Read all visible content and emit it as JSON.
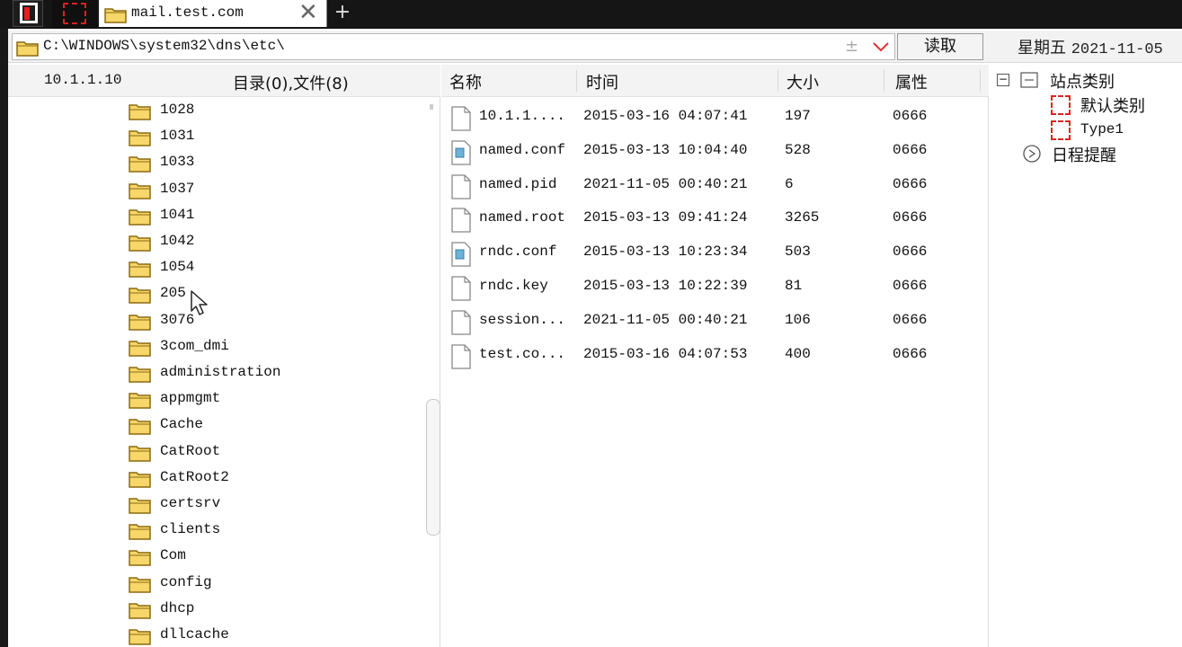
{
  "tab": {
    "title": "mail.test.com",
    "close": "✕",
    "new_tab": "+"
  },
  "address": {
    "path": "C:\\WINDOWS\\system32\\dns\\etc\\",
    "plusminus": "±",
    "read_button": "读取",
    "weekday": "星期五",
    "date": "2021-11-05"
  },
  "left_pane": {
    "host": "10.1.1.10",
    "summary": "目录(0),文件(8)",
    "folders": [
      "1028",
      "1031",
      "1033",
      "1037",
      "1041",
      "1042",
      "1054",
      "205",
      "3076",
      "3com_dmi",
      "administration",
      "appmgmt",
      "Cache",
      "CatRoot",
      "CatRoot2",
      "certsrv",
      "clients",
      "Com",
      "config",
      "dhcp",
      "dllcache"
    ]
  },
  "file_list": {
    "headers": {
      "name": "名称",
      "time": "时间",
      "size": "大小",
      "attr": "属性"
    },
    "rows": [
      {
        "name": "10.1.1....",
        "time": "2015-03-16 04:07:41",
        "size": "197",
        "attr": "0666",
        "icon": "blank-file-icon"
      },
      {
        "name": "named.conf",
        "time": "2015-03-13 10:04:40",
        "size": "528",
        "attr": "0666",
        "icon": "config-file-icon"
      },
      {
        "name": "named.pid",
        "time": "2021-11-05 00:40:21",
        "size": "6",
        "attr": "0666",
        "icon": "blank-file-icon"
      },
      {
        "name": "named.root",
        "time": "2015-03-13 09:41:24",
        "size": "3265",
        "attr": "0666",
        "icon": "blank-file-icon"
      },
      {
        "name": "rndc.conf",
        "time": "2015-03-13 10:23:34",
        "size": "503",
        "attr": "0666",
        "icon": "config-file-icon"
      },
      {
        "name": "rndc.key",
        "time": "2015-03-13 10:22:39",
        "size": "81",
        "attr": "0666",
        "icon": "blank-file-icon"
      },
      {
        "name": "session...",
        "time": "2021-11-05 00:40:21",
        "size": "106",
        "attr": "0666",
        "icon": "blank-file-icon"
      },
      {
        "name": "test.co...",
        "time": "2015-03-16 04:07:53",
        "size": "400",
        "attr": "0666",
        "icon": "blank-file-icon"
      }
    ]
  },
  "right_pane": {
    "toggle": "−",
    "site_category": "站点类别",
    "default_category": "默认类别",
    "type1": "Type1",
    "schedule": "日程提醒"
  },
  "colors": {
    "accent_red": "#dd2222",
    "folder_yellow": "#f3c64a",
    "titlebar": "#151515"
  }
}
